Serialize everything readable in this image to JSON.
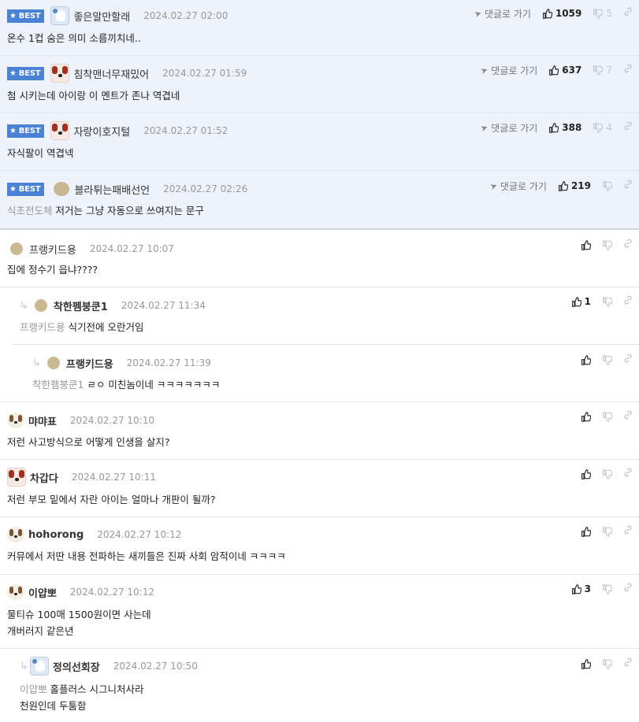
{
  "best_label": "BEST",
  "goto_label": "댓글로 가기",
  "comments": [
    {
      "nick": "좋은말만할래",
      "date": "2024.02.27 02:00",
      "body": "온수 1컵 숨은 의미 소름끼치네..",
      "up": "1059",
      "down": "5"
    },
    {
      "nick": "침착맨너무재밌어",
      "date": "2024.02.27 01:59",
      "body": "첨 시키는데 아이랑 이 멘트가 존나 역겹네",
      "up": "637",
      "down": "7"
    },
    {
      "nick": "자랑이호지털",
      "date": "2024.02.27 01:52",
      "body": "자식팔이 역겹넥",
      "up": "388",
      "down": "4"
    },
    {
      "nick": "블라튀는패배선언",
      "date": "2024.02.27 02:26",
      "mention": "식초전도체",
      "body": "저거는 그냥 자동으로 쓰여지는 문구",
      "up": "219",
      "down": ""
    },
    {
      "nick": "프랭키드용",
      "date": "2024.02.27 10:07",
      "body": "집에 정수기 읍냐????",
      "up": "",
      "down": ""
    },
    {
      "nick": "착한펨붕쿤1",
      "date": "2024.02.27 11:34",
      "mention": "프랭키드용",
      "body": "식기전에 오란거임",
      "up": "1",
      "down": ""
    },
    {
      "nick": "프랭키드용",
      "date": "2024.02.27 11:39",
      "mention": "착한펨붕쿤1",
      "body": "ㄹㅇ 미친놈이네 ㅋㅋㅋㅋㅋㅋㅋ",
      "up": "",
      "down": ""
    },
    {
      "nick": "먀먀표",
      "date": "2024.02.27 10:10",
      "body": "저런 사고방식으로 어떻게 인생을 살지?",
      "up": "",
      "down": ""
    },
    {
      "nick": "차갑다",
      "date": "2024.02.27 10:11",
      "body": "저런 부모 밑에서 자란 아이는 얼마나 개판이 될까?",
      "up": "",
      "down": ""
    },
    {
      "nick": "hohorong",
      "date": "2024.02.27 10:12",
      "body": "커뮤에서 저딴 내용 전파하는 새끼들은 진짜 사회 암적이네 ㅋㅋㅋㅋ",
      "up": "",
      "down": ""
    },
    {
      "nick": "이얍뽀",
      "date": "2024.02.27 10:12",
      "body": "물티슈 100매 1500원이면 사는데",
      "body2": "개버러지 같은년",
      "up": "3",
      "down": ""
    },
    {
      "nick": "정의선회장",
      "date": "2024.02.27 10:50",
      "mention": "이얍뽀",
      "body": "홀플러스 시그니처사라",
      "body2": "천원인데 두툼함",
      "up": "",
      "down": ""
    }
  ]
}
